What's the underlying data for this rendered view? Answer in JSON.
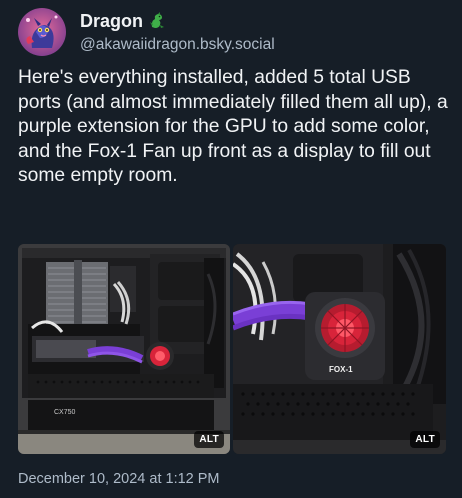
{
  "author": {
    "display_name": "Dragon",
    "name_emoji": "dragon-emoji-icon",
    "handle": "@akawaiidragon.bsky.social",
    "avatar": "avatar-dragon-character"
  },
  "post": {
    "text": "Here's everything installed, added 5 total USB ports (and almost immediately filled them all up), a purple extension for the GPU to add some color, and the Fox-1 Fan up front as a display to fill out some empty room."
  },
  "images": {
    "left": {
      "alt_label": "ALT",
      "photo_text": "CX750",
      "subject": "pc-case-interior-photo"
    },
    "right": {
      "alt_label": "ALT",
      "photo_text": "FOX-1",
      "subject": "fox-1-fan-closeup-photo"
    }
  },
  "meta": {
    "timestamp": "December 10, 2024 at 1:12 PM"
  },
  "colors": {
    "background": "#161e27",
    "text_primary": "#f1f3f5",
    "text_secondary": "#aebbc9",
    "accent_purple": "#7a3fd6",
    "accent_red": "#d8243a"
  }
}
